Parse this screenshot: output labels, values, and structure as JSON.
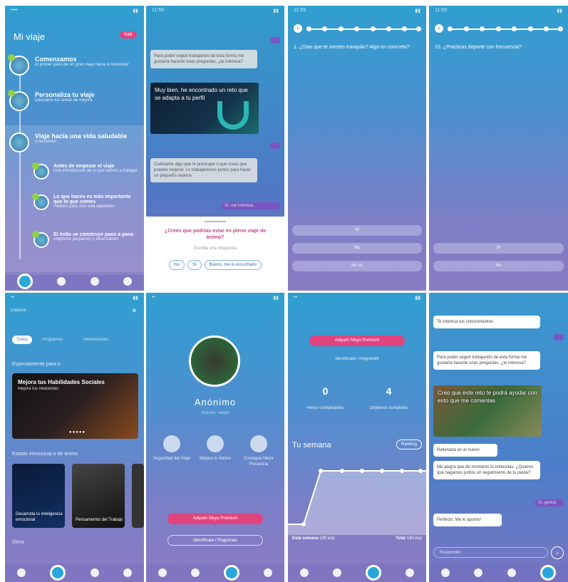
{
  "s1": {
    "title": "Mi viaje",
    "logout": "Salir",
    "m1": {
      "t": "Comenzamos",
      "d": "El primer paso de un gran viaje hacia el bienestar"
    },
    "m2": {
      "t": "Personaliza tu viaje",
      "d": "Descubre tus áreas de mejora"
    },
    "m3": {
      "t": "Viaje hacia una vida saludable",
      "d": "3 lecciones"
    },
    "l1": {
      "t": "Antes de empezar el viaje",
      "d": "Una introducción de lo que vamos a trabajar"
    },
    "l2": {
      "t": "Lo que haces es más importante que lo que comes",
      "d": "Hábitos para una vida saludable"
    },
    "l3": {
      "t": "El éxito se construye paso a paso",
      "d": "Objetivos pequeños y alcanzables"
    }
  },
  "s2": {
    "b1": "Para poder seguir trabajando de esta forma me gustaría hacerte unas preguntas, ¿te interesa?",
    "img": "Muy bien, he encontrado un reto que se adapta a tu perfil",
    "b2": "Cuéntame algo que te preocupe o que creas que puedes mejorar. Lo trabajaremos juntos para hacer un pequeño avance.",
    "me": "Sí, me interesa",
    "q": "¿Crees que podrías estar en pleno viaje de ánimo?",
    "ph": "Escribe una respuesta",
    "o1": "No",
    "o2": "Sí",
    "o3": "Bueno, me lo escuchado"
  },
  "s3": {
    "q": "1. ¿Días que te sientes tranquilo? Algo en concreto?",
    "o1": "Sí",
    "o2": "No",
    "o3": "No sé"
  },
  "s4": {
    "q": "10. ¿Practicas deporte con frecuencia?",
    "o1": "Sí",
    "o2": "No"
  },
  "s5": {
    "hd": "Explorar",
    "tabs": [
      "Todos",
      "Programas",
      "Meditaciones"
    ],
    "sec1": "Especialmente para ti",
    "card": "Mejora tus Habilidades Sociales",
    "cardsub": "Mejora tus relaciones",
    "sec2": "Estado emocional o de ánimo",
    "c1": "Desarrolla tu inteligencia emocional",
    "c2": "Pensamiento del Trabajo",
    "sec3": "Otros"
  },
  "s6": {
    "name": "Anónimo",
    "ns": "Método Tianjin",
    "b1": "Seguridad del Viaje",
    "b2": "Mejora tu Ánimo",
    "b3": "Consigue Mejor Presencia",
    "prem": "Adquirir Meyo Premium",
    "reg": "Identificate / Regístrate"
  },
  "s7": {
    "prem": "Adquirir Meyo Premium",
    "reg": "Identificate / Regístrate",
    "n1": "0",
    "l1": "Retos completados",
    "n2": "4",
    "l2": "Objetivos cumplidos",
    "week": "Tu semana",
    "rank": "Ranking",
    "this": "Esta semana",
    "thisv": "130 exp",
    "total": "Total",
    "totalv": "130 exp"
  },
  "s8": {
    "top": "Te interesa tus conocimientos",
    "b1": "Para poder seguir trabajando de esta forma me gustaría hacerte unas preguntas, ¿te interesa?",
    "img": "Creo que este reto te podrá ayudar con esto que me comentas",
    "b2": "Rellenarla en el nuevo",
    "b3": "Me alegra que de momento lo entiendas. ¿Quieres que hagamos juntos un seguimiento de tu pauta?",
    "me": "Sí, genial",
    "b4": "Perfecto. Me lo apunto!",
    "ph": "Responder"
  }
}
